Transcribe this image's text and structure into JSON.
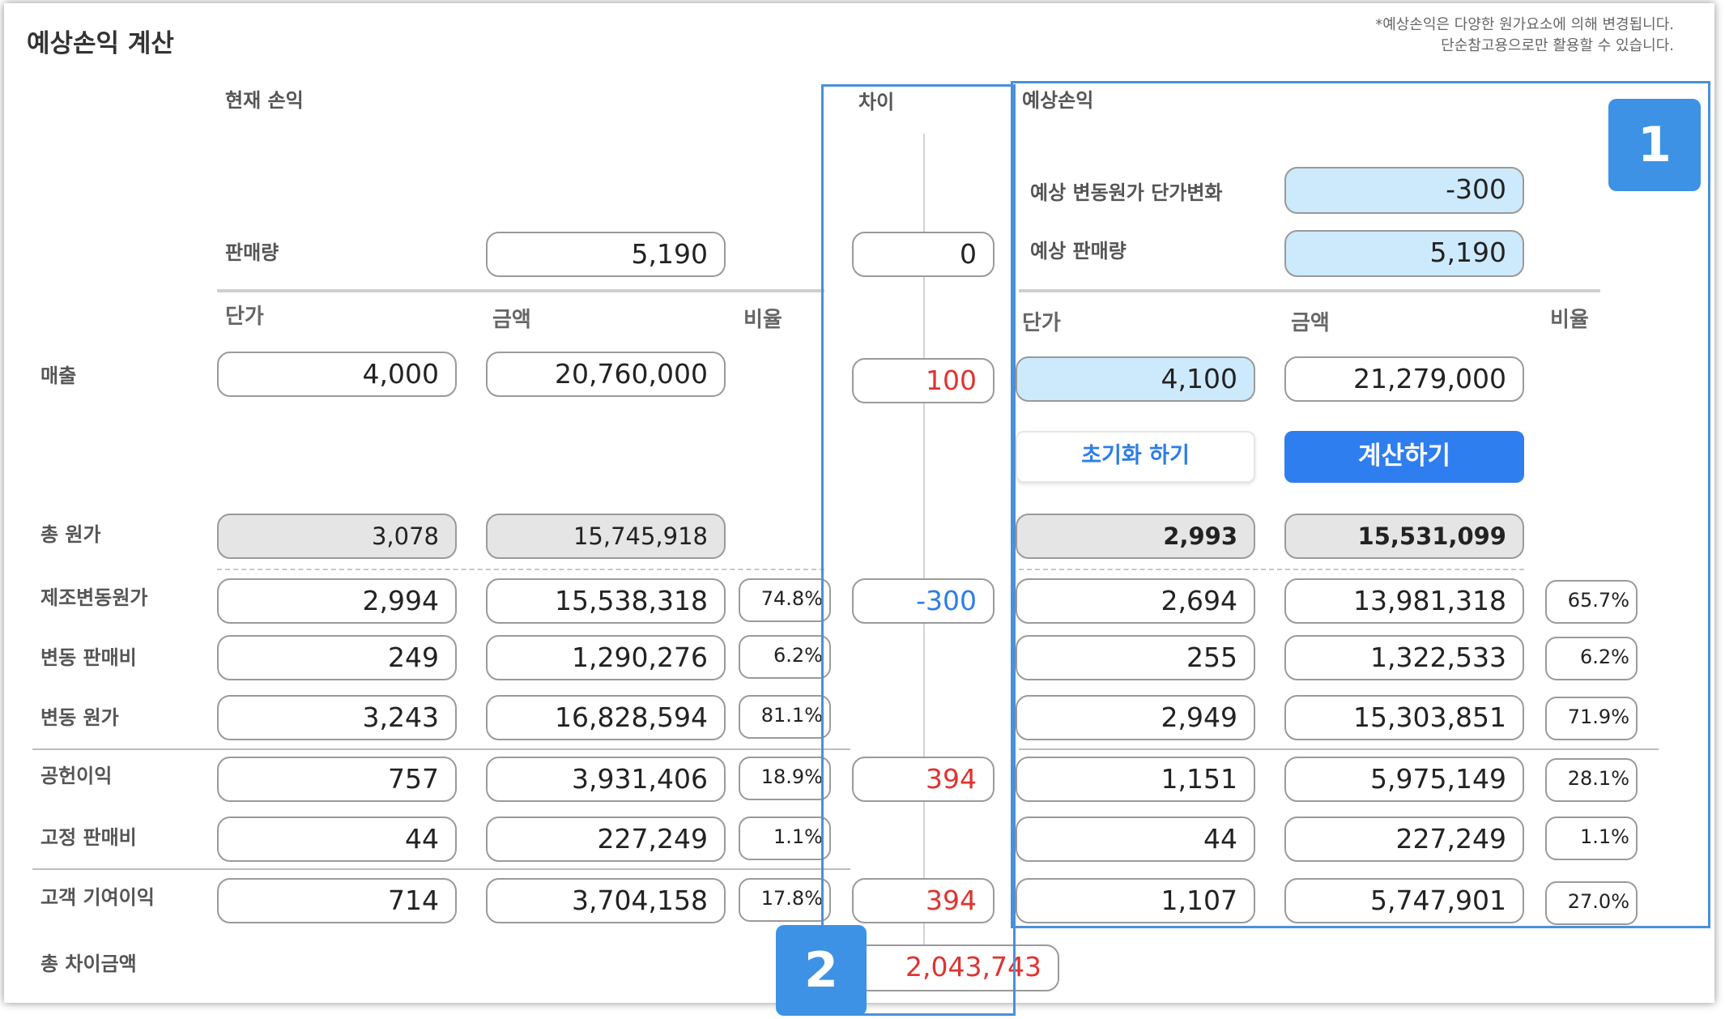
{
  "header": {
    "title": "예상손익 계산",
    "notice_line1": "*예상손익은 다양한 원가요소에 의해 변경됩니다.",
    "notice_line2": "단순참고용으로만 활용할 수 있습니다."
  },
  "sections": {
    "current": "현재 손익",
    "diff": "차이",
    "expected": "예상손익"
  },
  "columns": {
    "unit_price": "단가",
    "amount": "금액",
    "ratio": "비율"
  },
  "expected_inputs": {
    "var_cost_change_label": "예상 변동원가 단가변화",
    "var_cost_change_value": "-300",
    "sales_volume_label": "예상 판매량",
    "sales_volume_value": "5,190"
  },
  "buttons": {
    "reset": "초기화 하기",
    "calculate": "계산하기"
  },
  "markers": {
    "one": "1",
    "two": "2"
  },
  "rows": {
    "sales_volume": {
      "label": "판매량",
      "current_amount": "5,190",
      "diff": "0"
    },
    "revenue": {
      "label": "매출",
      "cur_unit": "4,000",
      "cur_amount": "20,760,000",
      "diff": "100",
      "exp_unit": "4,100",
      "exp_amount": "21,279,000"
    },
    "total_cost": {
      "label": "총 원가",
      "cur_unit": "3,078",
      "cur_amount": "15,745,918",
      "exp_unit": "2,993",
      "exp_amount": "15,531,099"
    },
    "mfg_var_cost": {
      "label": "제조변동원가",
      "cur_unit": "2,994",
      "cur_amount": "15,538,318",
      "cur_ratio": "74.8%",
      "diff": "-300",
      "exp_unit": "2,694",
      "exp_amount": "13,981,318",
      "exp_ratio": "65.7%"
    },
    "var_selling": {
      "label": "변동 판매비",
      "cur_unit": "249",
      "cur_amount": "1,290,276",
      "cur_ratio": "6.2%",
      "exp_unit": "255",
      "exp_amount": "1,322,533",
      "exp_ratio": "6.2%"
    },
    "var_cost": {
      "label": "변동 원가",
      "cur_unit": "3,243",
      "cur_amount": "16,828,594",
      "cur_ratio": "81.1%",
      "exp_unit": "2,949",
      "exp_amount": "15,303,851",
      "exp_ratio": "71.9%"
    },
    "contribution": {
      "label": "공헌이익",
      "cur_unit": "757",
      "cur_amount": "3,931,406",
      "cur_ratio": "18.9%",
      "diff": "394",
      "exp_unit": "1,151",
      "exp_amount": "5,975,149",
      "exp_ratio": "28.1%"
    },
    "fixed_selling": {
      "label": "고정 판매비",
      "cur_unit": "44",
      "cur_amount": "227,249",
      "cur_ratio": "1.1%",
      "exp_unit": "44",
      "exp_amount": "227,249",
      "exp_ratio": "1.1%"
    },
    "customer_contribution": {
      "label": "고객 기여이익",
      "cur_unit": "714",
      "cur_amount": "3,704,158",
      "cur_ratio": "17.8%",
      "diff": "394",
      "exp_unit": "1,107",
      "exp_amount": "5,747,901",
      "exp_ratio": "27.0%"
    },
    "total_diff": {
      "label": "총 차이금액",
      "diff": "2,043,743"
    }
  }
}
